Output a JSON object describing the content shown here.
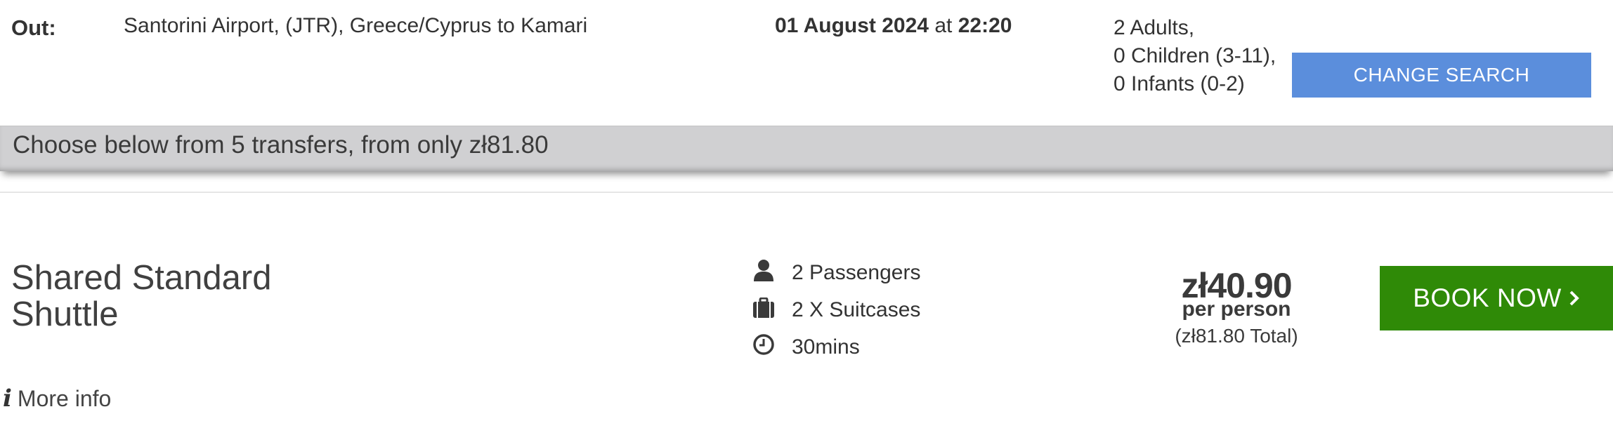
{
  "search": {
    "direction_label": "Out:",
    "route": "Santorini Airport, (JTR), Greece/Cyprus to Kamari",
    "date": "01 August 2024",
    "at": "at",
    "time": "22:20",
    "passengers": {
      "adults": "2 Adults,",
      "children": "0 Children (3-11),",
      "infants": "0 Infants (0-2)"
    },
    "change_button": "CHANGE SEARCH"
  },
  "banner": {
    "text": "Choose below from 5 transfers, from only zł81.80"
  },
  "transfer": {
    "vehicle_line1": "Shared Standard",
    "vehicle_line2": "Shuttle",
    "features": [
      {
        "icon": "person-icon",
        "label": "2 Passengers"
      },
      {
        "icon": "suitcase-icon",
        "label": "2 X Suitcases"
      },
      {
        "icon": "clock-icon",
        "label": "30mins"
      }
    ],
    "price": "zł40.90",
    "price_unit": "per person",
    "price_total": "(zł81.80 Total)",
    "book_button": "BOOK NOW",
    "more_info": "More info"
  },
  "colors": {
    "change_button": "#5b8edc",
    "book_button": "#2f8a07",
    "banner": "#d0d0d2"
  }
}
